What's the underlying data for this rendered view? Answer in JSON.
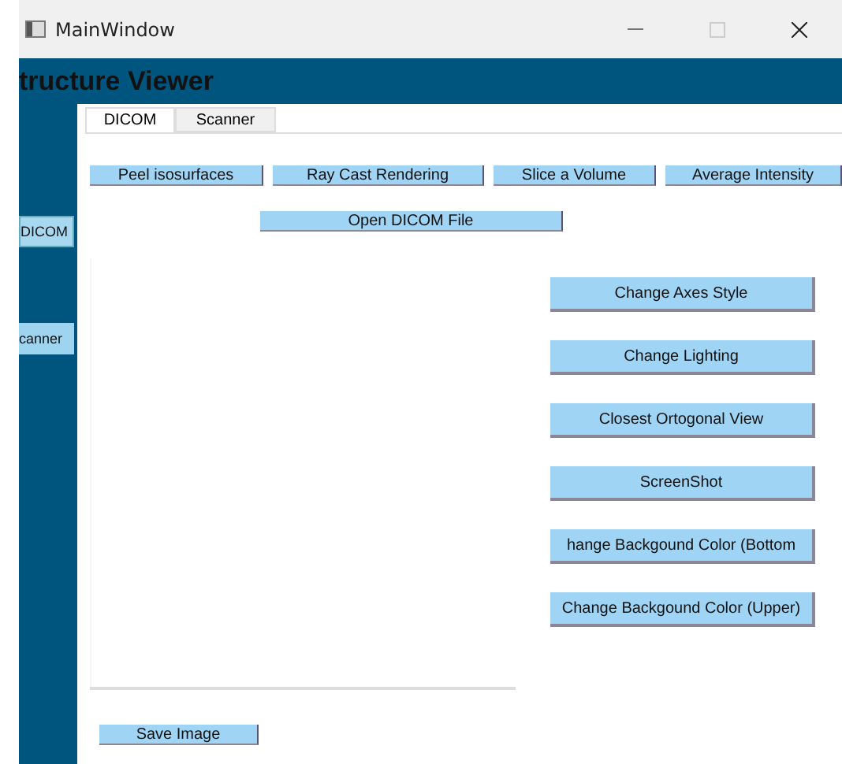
{
  "window": {
    "title": "MainWindow"
  },
  "header": {
    "title": "tructure Viewer"
  },
  "sidebar": {
    "items": [
      {
        "label": "DICOM",
        "selected": true
      },
      {
        "label": "canner",
        "selected": false
      }
    ]
  },
  "tabs": [
    {
      "label": "DICOM",
      "selected": true
    },
    {
      "label": "Scanner",
      "selected": false
    }
  ],
  "toolbar_buttons": [
    "Peel isosurfaces",
    "Ray Cast Rendering",
    "Slice a Volume",
    "Average Intensity"
  ],
  "open_button": "Open DICOM File",
  "side_buttons": [
    "Change Axes Style",
    "Change Lighting",
    "Closest Ortogonal View",
    "ScreenShot",
    "hange Backgound Color (Bottom",
    "Change Backgound Color (Upper)"
  ],
  "save_button": "Save Image"
}
